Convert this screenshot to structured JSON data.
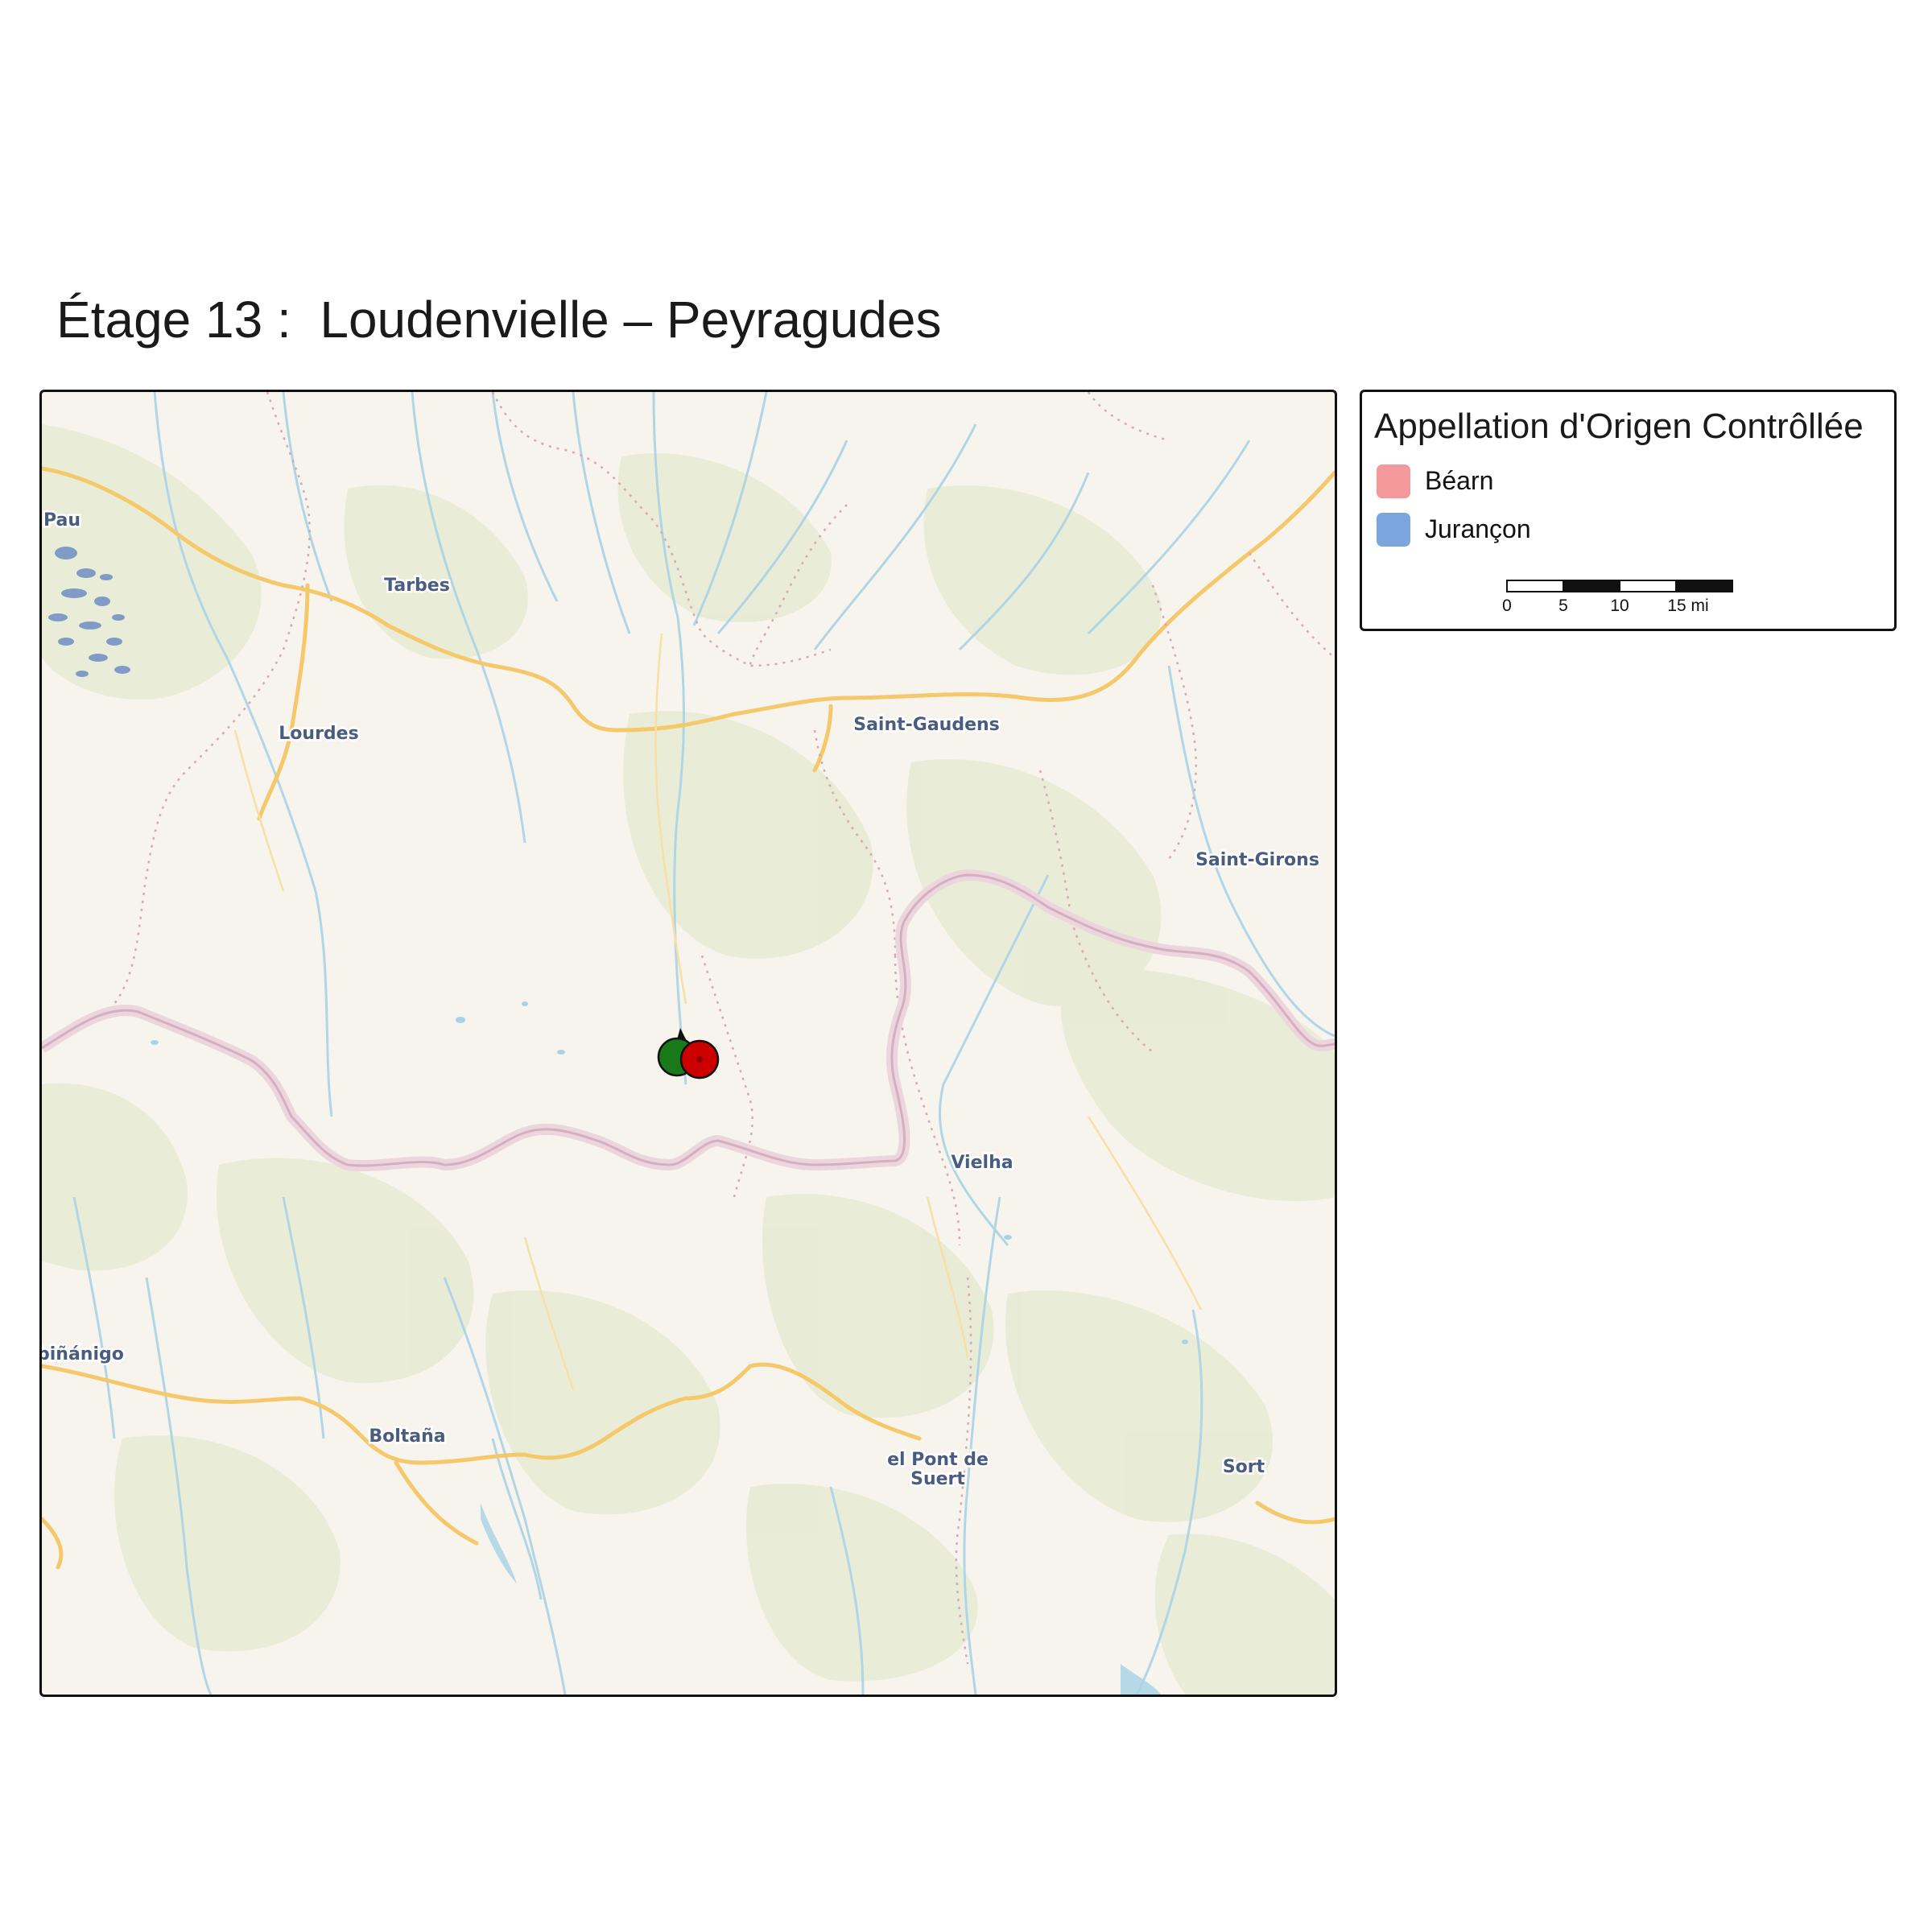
{
  "title": "Étage 13 :  Loudenvielle – Peyragudes",
  "legend": {
    "title": "Appellation d'Origen Contrôllée",
    "items": [
      {
        "label": "Béarn",
        "color": "#f4999b"
      },
      {
        "label": "Jurançon",
        "color": "#7aa5dd"
      }
    ],
    "scale": {
      "ticks": [
        "0",
        "5",
        "10",
        "15 mi"
      ]
    }
  },
  "map": {
    "places": [
      "Pau",
      "Tarbes",
      "Lourdes",
      "Saint-Gaudens",
      "Saint-Girons",
      "Vielha",
      "biñánigo",
      "Boltaña",
      "el Pont de",
      "Suert",
      "Sort"
    ],
    "markers": [
      {
        "name": "start-marker",
        "color": "#1a7a1a"
      },
      {
        "name": "finish-marker",
        "color": "#cc0000"
      }
    ],
    "colors": {
      "background": "#f7f4ee",
      "vegetation": "#e7ecd6",
      "rivers": "#a9d3e5",
      "roads": "#f5c96b",
      "border": "#d9b6c0"
    }
  }
}
